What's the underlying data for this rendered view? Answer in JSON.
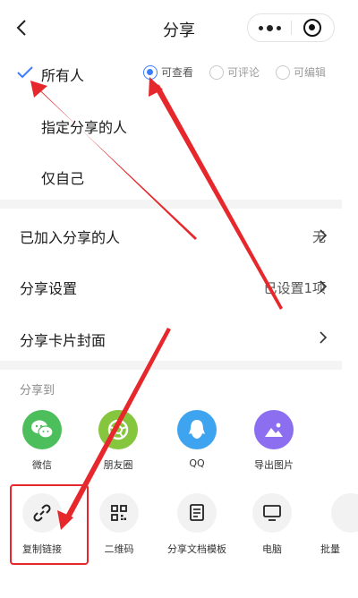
{
  "nav": {
    "title": "分享"
  },
  "visibility": {
    "options": [
      {
        "label": "所有人",
        "selected": true
      },
      {
        "label": "指定分享的人",
        "selected": false
      },
      {
        "label": "仅自己",
        "selected": false
      }
    ],
    "permissions": [
      {
        "label": "可查看",
        "selected": true
      },
      {
        "label": "可评论",
        "selected": false
      },
      {
        "label": "可编辑",
        "selected": false
      }
    ]
  },
  "settings": [
    {
      "label": "已加入分享的人",
      "value": "无"
    },
    {
      "label": "分享设置",
      "value": "已设置1项"
    },
    {
      "label": "分享卡片封面",
      "value": ""
    }
  ],
  "share": {
    "section_title": "分享到",
    "targets": [
      {
        "label": "微信",
        "color": "#4cbf5c",
        "icon": "wechat-icon"
      },
      {
        "label": "朋友圈",
        "color": "#86c63f",
        "icon": "moments-icon"
      },
      {
        "label": "QQ",
        "color": "#3ea4f0",
        "icon": "qq-icon"
      },
      {
        "label": "导出图片",
        "color": "#8c6ff0",
        "icon": "image-icon"
      }
    ],
    "tools": [
      {
        "label": "复制链接",
        "icon": "link-icon"
      },
      {
        "label": "二维码",
        "icon": "qr-code-icon"
      },
      {
        "label": "分享文档模板",
        "icon": "template-icon"
      },
      {
        "label": "电脑",
        "icon": "computer-icon"
      },
      {
        "label": "批量",
        "icon": "batch-icon"
      }
    ]
  },
  "colors": {
    "accent": "#3d7cff",
    "annotation": "#e6272b"
  }
}
